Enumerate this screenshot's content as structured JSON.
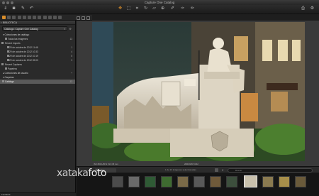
{
  "window": {
    "title": "Capture One Catalog"
  },
  "toolbar": {
    "items": [
      {
        "icon": "import-icon",
        "label": ""
      },
      {
        "icon": "camera-icon",
        "label": ""
      },
      {
        "icon": "edit-icon",
        "label": ""
      },
      {
        "icon": "undo-icon",
        "label": ""
      }
    ],
    "cursor_tools": [
      "pan-icon",
      "select-icon",
      "crop-icon",
      "rotate-icon",
      "keystone-icon",
      "spot-icon",
      "picker-icon",
      "wb-picker-icon",
      "annotate-icon"
    ],
    "right_tools": [
      "print-icon",
      "gear-icon"
    ]
  },
  "library": {
    "header": "BIBLIOTECA",
    "catalog_select": "Catálogo: Capture One Catalog",
    "sections": {
      "collections": "Colecciones de catálogo",
      "all_images": {
        "label": "Todas las imágenes",
        "count": "13"
      },
      "recent_imports": "Recent Imports",
      "imports": [
        {
          "label": "29 de octubre de 2012 11:46",
          "count": "1"
        },
        {
          "label": "29 de octubre de 2012 10:33",
          "count": "4"
        },
        {
          "label": "29 de octubre de 2012 10:19",
          "count": "5"
        },
        {
          "label": "29 de octubre de 2012 09:03",
          "count": "3"
        }
      ],
      "recent_captures": "Recent Captures",
      "trash": "Papelera",
      "user_collections": "Colecciones de usuario",
      "folders": "Carpetas",
      "catalog_row": {
        "label": "Catálogo",
        "count": "13"
      }
    },
    "filter_label": "FILTROS"
  },
  "viewer": {
    "meta_left": "ISO 800   1/80 S   f/1.8   35 mm",
    "meta_right": "20RC9457.CR2"
  },
  "browser": {
    "sort_label": "Nombre",
    "count_text": "1 de 13 imágenes seleccionadas",
    "search_placeholder": "Buscar"
  },
  "watermark": {
    "prefix": "xataka",
    "suffix": "foto"
  },
  "colors": {
    "accent": "#d98d2a",
    "panel": "#2a2a2a",
    "selection": "#5a5a5a"
  }
}
